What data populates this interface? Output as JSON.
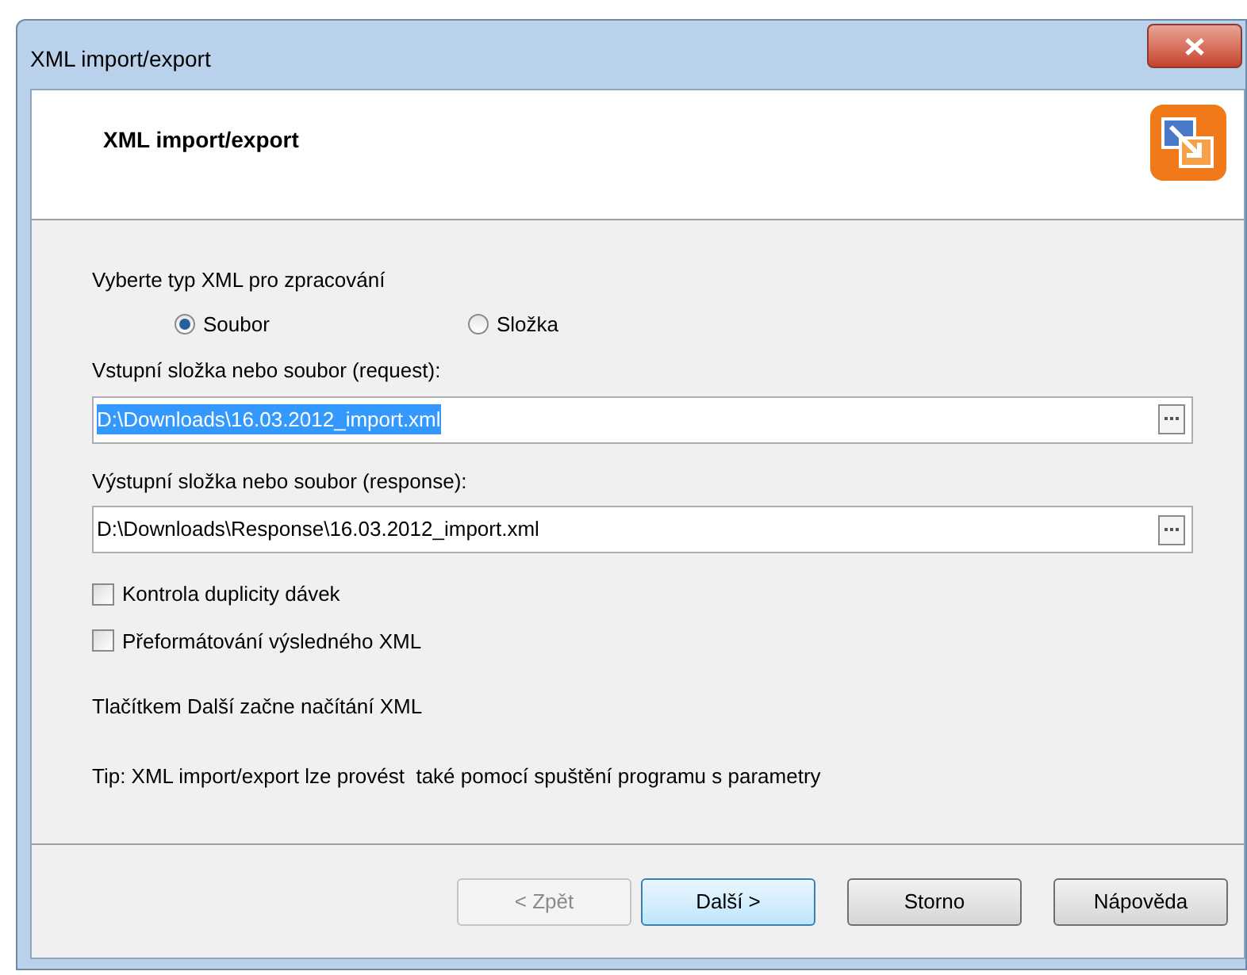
{
  "window": {
    "title": "XML import/export"
  },
  "header": {
    "title": "XML import/export"
  },
  "type_choice": {
    "label": "Vyberte typ XML pro zpracování",
    "options": [
      {
        "label": "Soubor",
        "selected": true
      },
      {
        "label": "Složka",
        "selected": false
      }
    ]
  },
  "fields": [
    {
      "label": "Vstupní složka nebo soubor (request):",
      "value": "D:\\Downloads\\16.03.2012_import.xml",
      "text_selected": true
    },
    {
      "label": "Výstupní složka nebo soubor (response):",
      "value": "D:\\Downloads\\Response\\16.03.2012_import.xml",
      "text_selected": false
    }
  ],
  "checkboxes": [
    {
      "label": "Kontrola duplicity dávek",
      "checked": false
    },
    {
      "label": "Přeformátování výsledného XML",
      "checked": false
    }
  ],
  "notes": [
    "Tlačítkem Další začne načítání XML",
    "Tip: XML import/export lze provést  také pomocí spuštění programu s parametry"
  ],
  "buttons": [
    {
      "label": "< Zpět",
      "disabled": true,
      "default": false
    },
    {
      "label": "Další >",
      "disabled": false,
      "default": true
    },
    {
      "label": "Storno",
      "disabled": false,
      "default": false
    },
    {
      "label": "Nápověda",
      "disabled": false,
      "default": false
    }
  ]
}
